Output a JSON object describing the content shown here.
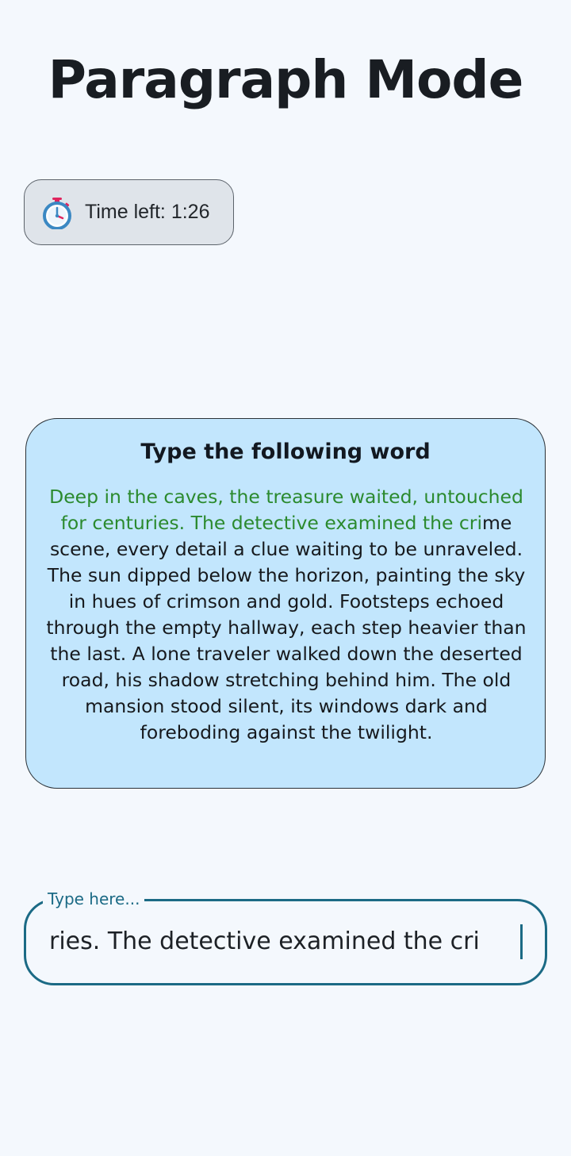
{
  "header": {
    "title": "Paragraph Mode"
  },
  "timer": {
    "icon": "stopwatch-icon",
    "label": "Time left: 1:26"
  },
  "prompt_card": {
    "title": "Type the following word",
    "typed_text": "Deep in the caves, the treasure waited, untouched for centuries. The detective examined the cri",
    "remaining_text": "me scene, every detail a clue waiting to be unraveled. The sun dipped below the horizon, painting the sky in hues of crimson and gold. Footsteps echoed through the empty hallway, each step heavier than the last. A lone traveler walked down the deserted road, his shadow stretching behind him. The old mansion stood silent, its windows dark and foreboding against the twilight."
  },
  "input": {
    "label": "Type here...",
    "value": "ries. The detective examined the cri"
  },
  "colors": {
    "background": "#f4f8fd",
    "card_background": "#c2e6fd",
    "typed_text": "#2b8a2e",
    "field_accent": "#1b6a85"
  }
}
